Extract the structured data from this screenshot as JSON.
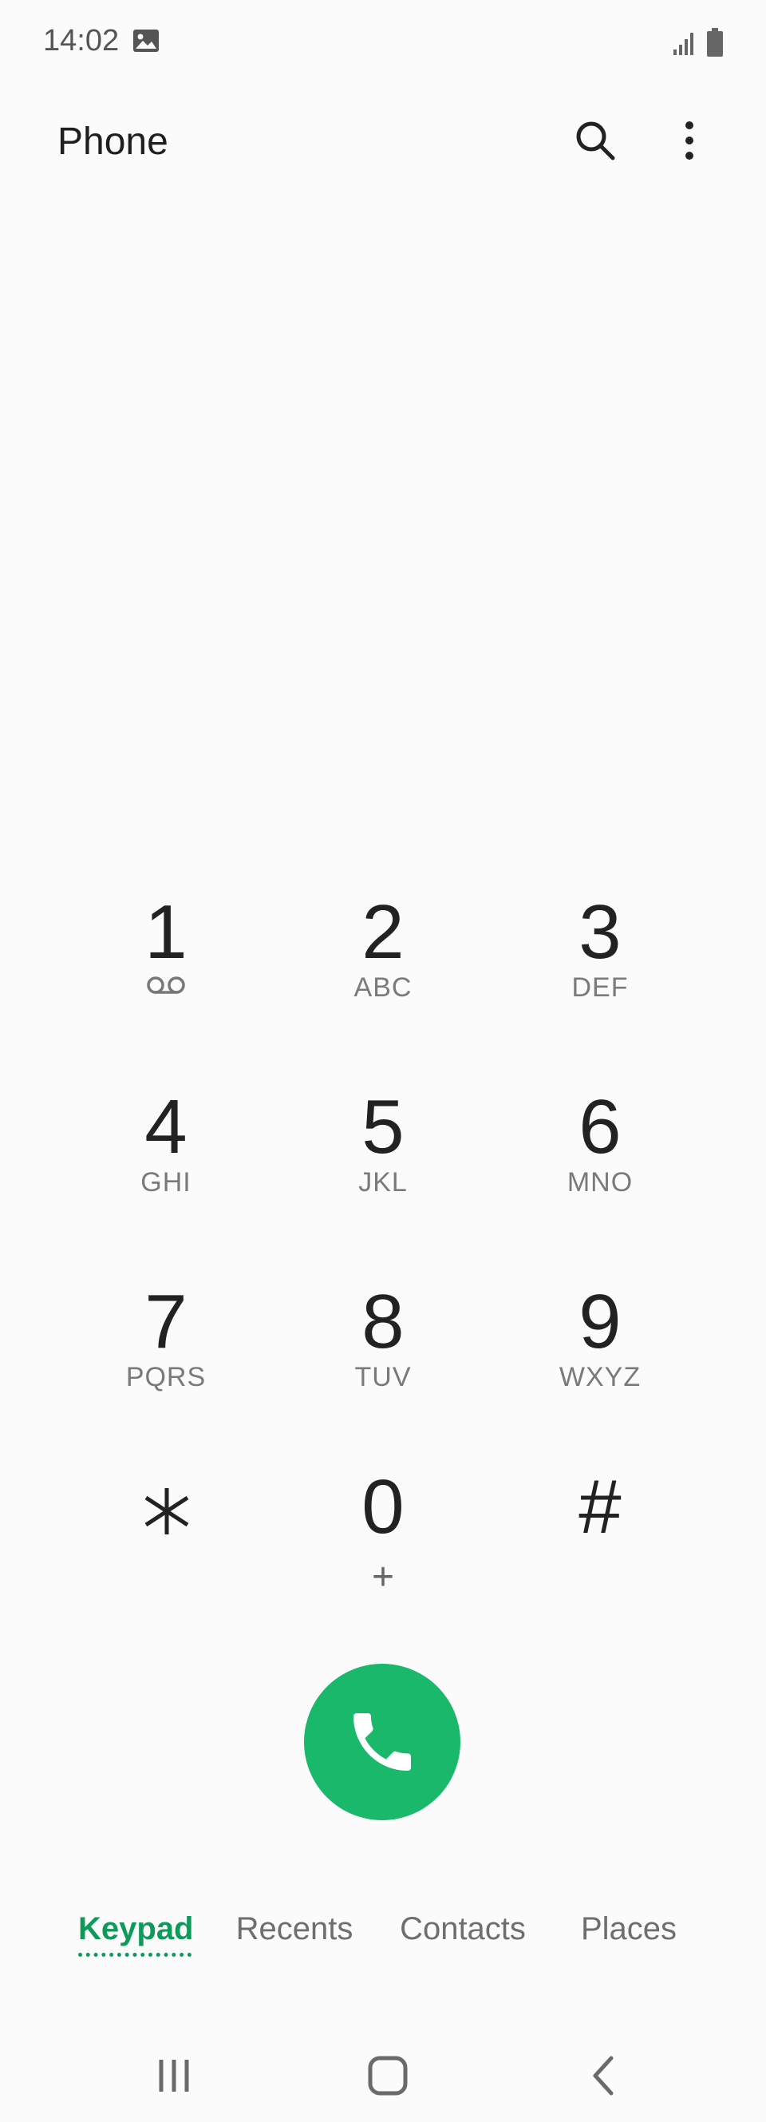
{
  "status_bar": {
    "time": "14:02",
    "icons": [
      "gallery-icon",
      "signal-icon",
      "battery-icon"
    ]
  },
  "app_bar": {
    "title": "Phone",
    "actions": [
      "search-icon",
      "more-options-icon"
    ]
  },
  "dialer": {
    "entered_number": ""
  },
  "keypad": {
    "keys": [
      {
        "digit": "1",
        "letters": "",
        "sub_icon": "voicemail-icon"
      },
      {
        "digit": "2",
        "letters": "ABC"
      },
      {
        "digit": "3",
        "letters": "DEF"
      },
      {
        "digit": "4",
        "letters": "GHI"
      },
      {
        "digit": "5",
        "letters": "JKL"
      },
      {
        "digit": "6",
        "letters": "MNO"
      },
      {
        "digit": "7",
        "letters": "PQRS"
      },
      {
        "digit": "8",
        "letters": "TUV"
      },
      {
        "digit": "9",
        "letters": "WXYZ"
      },
      {
        "digit": "*",
        "letters": "",
        "glyph_icon": "asterisk-icon"
      },
      {
        "digit": "0",
        "letters": "+"
      },
      {
        "digit": "#",
        "letters": ""
      }
    ]
  },
  "call_button": {
    "icon": "phone-icon",
    "color": "#19b86a"
  },
  "tabs": [
    {
      "label": "Keypad",
      "active": true
    },
    {
      "label": "Recents",
      "active": false
    },
    {
      "label": "Contacts",
      "active": false
    },
    {
      "label": "Places",
      "active": false
    }
  ],
  "colors": {
    "accent": "#0e9a5a",
    "call_green": "#19b86a",
    "background": "#fbfbfb"
  },
  "nav_bar": {
    "buttons": [
      "recent-apps-icon",
      "home-icon",
      "back-icon"
    ]
  }
}
